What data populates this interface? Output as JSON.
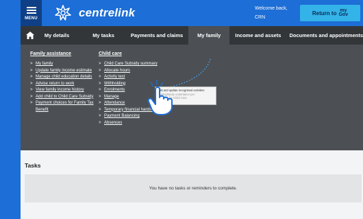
{
  "header": {
    "menu_label": "MENU",
    "logo_text": "centrelink",
    "welcome_line1": "Welcome back,",
    "welcome_line2": "CRN",
    "return_label": "Return to",
    "mygov_line1": "my",
    "mygov_line2": "Gov"
  },
  "nav": {
    "items": [
      {
        "label": "My details"
      },
      {
        "label": "My tasks"
      },
      {
        "label": "Payments and claims"
      },
      {
        "label": "My family"
      },
      {
        "label": "Income and assets"
      },
      {
        "label": "Documents and appointments"
      }
    ]
  },
  "dropdown": {
    "family_assistance": {
      "heading": "Family assistance",
      "links": [
        "My family",
        "Update family income estimate",
        "Manage child education details",
        "Advise return to work",
        "View family income history",
        "Add child to Child Care Subsidy"
      ],
      "wrap_link_line1": "Payment choices for Family Tax",
      "wrap_link_line2": "Benefit"
    },
    "child_care": {
      "heading": "Child care",
      "links": [
        "Child Care Subsidy summary",
        "Allocate hours",
        "Activity test",
        "Withholding",
        "Enrolments",
        "Manage",
        "Attendance",
        "Temporary financial hardship",
        "Payment Balancing",
        "Absences"
      ]
    },
    "tooltip": {
      "line1": "Add and update recognised activities",
      "line2": "training/study undertaken per",
      "line3": "eligibility for Child Care"
    }
  },
  "tasks": {
    "title": "Tasks",
    "message": "You have no tasks or reminders to complete."
  },
  "colors": {
    "brand_blue": "#1d6ed6",
    "nav_dark": "#333639",
    "menu_panel": "#4c5054",
    "return_button": "#34b3e8"
  }
}
